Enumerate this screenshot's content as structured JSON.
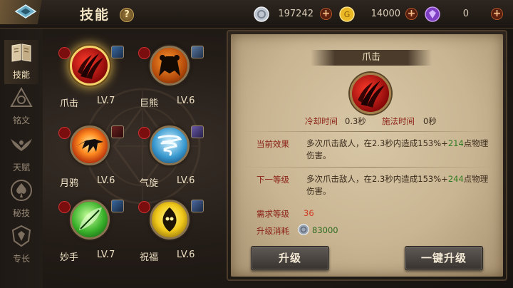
{
  "header": {
    "title": "技能",
    "help_label": "?"
  },
  "resources": [
    {
      "name": "silver",
      "icon": "silver-coin-icon",
      "value": "197242",
      "color": "#bfc6d0"
    },
    {
      "name": "gold",
      "icon": "gold-coin-icon",
      "value": "14000",
      "color": "#e9b824"
    },
    {
      "name": "diamond",
      "icon": "purple-gem-icon",
      "value": "0",
      "color": "#9a5ad8"
    }
  ],
  "sidebar": {
    "items": [
      {
        "label": "技能",
        "icon": "book-icon",
        "active": true
      },
      {
        "label": "铭文",
        "icon": "triangle-rune-icon",
        "active": false
      },
      {
        "label": "天赋",
        "icon": "wings-icon",
        "active": false
      },
      {
        "label": "秘技",
        "icon": "spade-emblem-icon",
        "active": false
      },
      {
        "label": "专长",
        "icon": "crest-icon",
        "active": false
      }
    ]
  },
  "skills": [
    {
      "name": "爪击",
      "level": "LV.7",
      "selected": true
    },
    {
      "name": "巨熊",
      "level": "LV.6",
      "selected": false
    },
    {
      "name": "月鸦",
      "level": "LV.6",
      "selected": false
    },
    {
      "name": "气旋",
      "level": "LV.6",
      "selected": false
    },
    {
      "name": "妙手",
      "level": "LV.7",
      "selected": false
    },
    {
      "name": "祝福",
      "level": "LV.6",
      "selected": false
    }
  ],
  "detail": {
    "title": "爪击",
    "cooldown_label": "冷却时间",
    "cooldown_value": "0.3秒",
    "cast_label": "施法时间",
    "cast_value": "0秒",
    "current_label": "当前效果",
    "current_text_a": "多次爪击敌人，在2.3秒内造成153%+",
    "current_text_bonus": "214",
    "current_text_b": "点物理伤害。",
    "next_label": "下一等级",
    "next_text_a": "多次爪击敌人，在2.3秒内造成153%+",
    "next_text_bonus": "244",
    "next_text_b": "点物理伤害。",
    "req_level_label": "需求等级",
    "req_level_value": "36",
    "cost_label": "升级消耗",
    "cost_value": "83000",
    "upgrade_button": "升级",
    "upgrade_all_button": "一键升级"
  },
  "colors": {
    "accent_gold": "#f6d36a",
    "effect_red": "#8a1e14",
    "bonus_green": "#2e7b22"
  }
}
